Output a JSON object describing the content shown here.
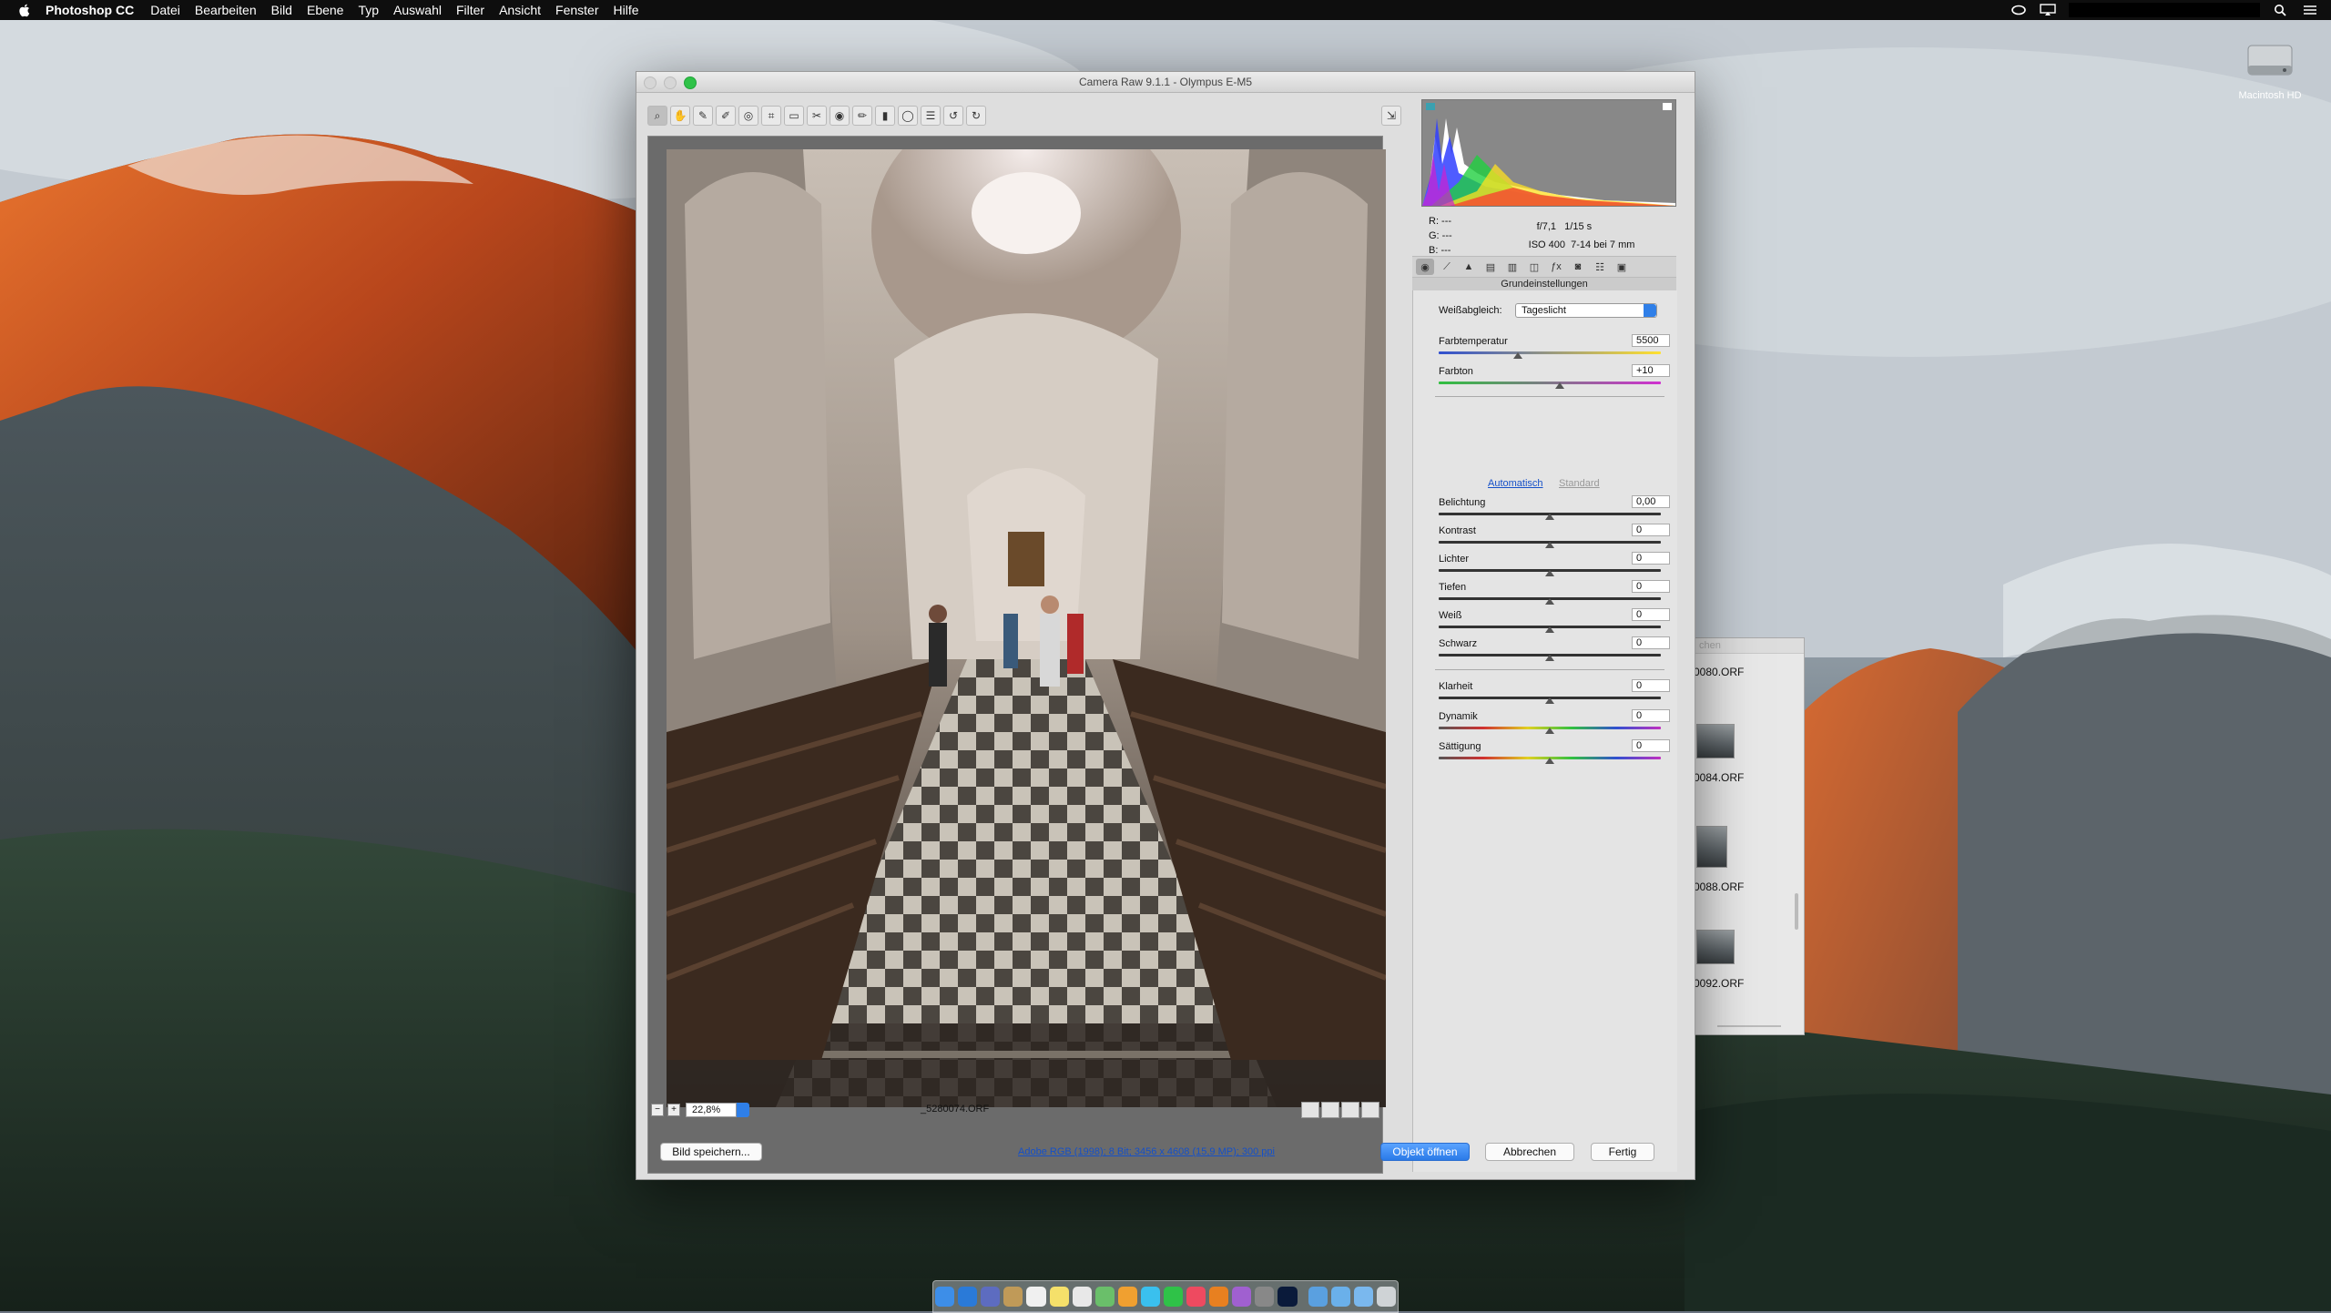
{
  "menubar": {
    "app_name": "Photoshop CC",
    "items": [
      "Datei",
      "Bearbeiten",
      "Bild",
      "Ebene",
      "Typ",
      "Auswahl",
      "Filter",
      "Ansicht",
      "Fenster",
      "Hilfe"
    ]
  },
  "desktop": {
    "drive_label": "Macintosh HD"
  },
  "bridge": {
    "header": "chen",
    "thumbs": [
      "0080.ORF",
      "0084.ORF",
      "0088.ORF",
      "0092.ORF"
    ]
  },
  "camera_raw": {
    "window_title": "Camera Raw 9.1.1 - Olympus E-M5",
    "status": {
      "zoom": "22,8%",
      "filename": "_5280074.ORF"
    },
    "histogram_info": {
      "r": "R:  ---",
      "g": "G:  ---",
      "b": "B:  ---",
      "aperture": "f/7,1",
      "shutter": "1/15 s",
      "iso": "ISO 400",
      "lens": "7-14 bei 7 mm"
    },
    "panel_title": "Grundeinstellungen",
    "white_balance": {
      "label": "Weißabgleich:",
      "value": "Tageslicht"
    },
    "temperature": {
      "label": "Farbtemperatur",
      "value": "5500"
    },
    "tint": {
      "label": "Farbton",
      "value": "+10"
    },
    "auto_label": "Automatisch",
    "default_label": "Standard",
    "tone_sliders": [
      {
        "label": "Belichtung",
        "value": "0,00"
      },
      {
        "label": "Kontrast",
        "value": "0"
      },
      {
        "label": "Lichter",
        "value": "0"
      },
      {
        "label": "Tiefen",
        "value": "0"
      },
      {
        "label": "Weiß",
        "value": "0"
      },
      {
        "label": "Schwarz",
        "value": "0"
      }
    ],
    "presence_sliders": [
      {
        "label": "Klarheit",
        "value": "0"
      },
      {
        "label": "Dynamik",
        "value": "0"
      },
      {
        "label": "Sättigung",
        "value": "0"
      }
    ],
    "buttons": {
      "save": "Bild speichern...",
      "workflow": "Adobe RGB (1998); 8 Bit; 3456 x 4608 (15,9 MP); 300 ppi",
      "open": "Objekt öffnen",
      "cancel": "Abbrechen",
      "done": "Fertig"
    }
  }
}
